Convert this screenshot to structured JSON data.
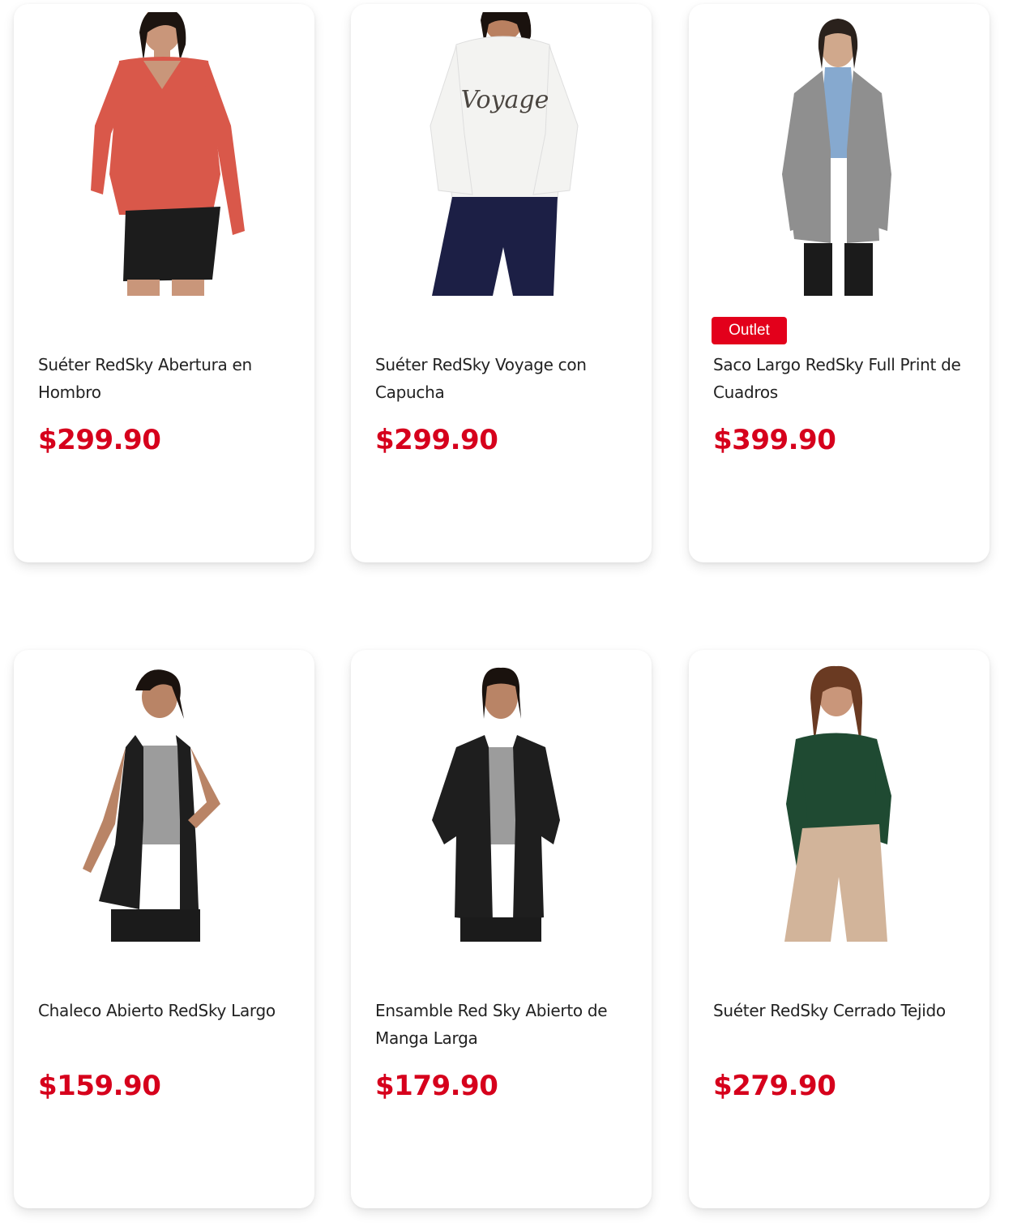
{
  "products": [
    {
      "title": "Suéter RedSky Abertura en Hombro",
      "price": "$299.90",
      "badge": "",
      "colors": {
        "skin": "#c9967a",
        "hair": "#1c1410",
        "top": "#d9584a",
        "bottom": "#1c1c1c",
        "legs": "#c9967a"
      }
    },
    {
      "title": "Suéter RedSky Voyage con Capucha",
      "price": "$299.90",
      "badge": "",
      "print": "Voyage",
      "colors": {
        "skin": "#b98060",
        "hair": "#1a120e",
        "top": "#f3f3f1",
        "bottom": "#1c1f45",
        "legs": "#1c1f45"
      }
    },
    {
      "title": "Saco Largo RedSky Full Print de Cuadros",
      "price": "$399.90",
      "badge": "Outlet",
      "colors": {
        "skin": "#d0a88c",
        "hair": "#2a211c",
        "top": "#8f8f8f",
        "inner": "#86a9cf",
        "bottom": "#1b1b1b",
        "legs": "#1b1b1b"
      }
    },
    {
      "title": "Chaleco Abierto RedSky Largo",
      "price": "$159.90",
      "badge": "",
      "colors": {
        "skin": "#b98466",
        "hair": "#1a120e",
        "top": "#1e1e1e",
        "inner": "#9c9c9c",
        "bottom": "#1b1b1b",
        "legs": "#1b1b1b"
      }
    },
    {
      "title": "Ensamble Red Sky Abierto de Manga Larga",
      "price": "$179.90",
      "badge": "",
      "colors": {
        "skin": "#b98466",
        "hair": "#1a120e",
        "top": "#1e1e1e",
        "inner": "#9c9c9c",
        "bottom": "#1b1b1b",
        "legs": "#1b1b1b"
      }
    },
    {
      "title": "Suéter RedSky Cerrado Tejido",
      "price": "$279.90",
      "badge": "",
      "colors": {
        "skin": "#c9967a",
        "hair": "#6a3a22",
        "top": "#1f4a32",
        "bottom": "#d2b49a",
        "legs": "#d2b49a"
      }
    }
  ]
}
